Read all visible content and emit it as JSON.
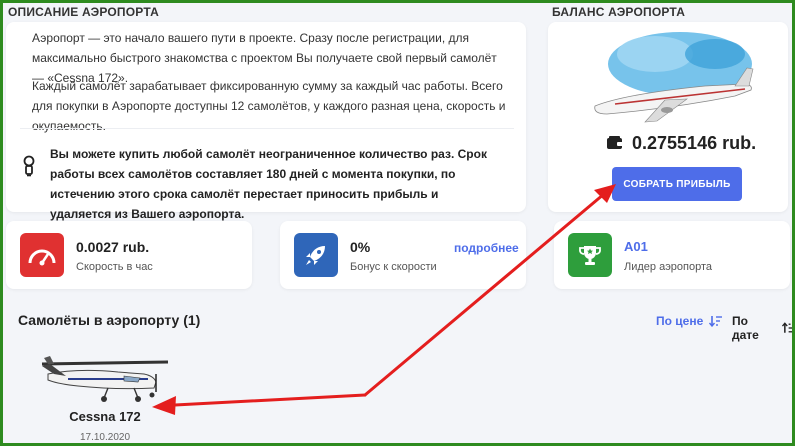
{
  "description": {
    "title": "ОПИСАНИЕ АЭРОПОРТА",
    "paragraph1": "Аэропорт — это начало вашего пути в проекте. Сразу после регистрации, для максимально быстрого знакомства с проектом Вы получаете свой первый самолёт — «Cessna 172».",
    "paragraph2": "Каждый самолёт зарабатывает фиксированную сумму за каждый час работы. Всего для покупки в Аэропорте доступны 12 самолётов, у каждого разная цена, скорость и окупаемость.",
    "notice": "Вы можете купить любой самолёт неограниченное количество раз. Срок работы всех самолётов составляет 180 дней с момента покупки, по истечению этого срока самолёт перестает приносить прибыль и удаляется из Вашего аэропорта."
  },
  "balance": {
    "title": "БАЛАНС АЭРОПОРТА",
    "amount": "0.2755146 rub.",
    "collect_label": "СОБРАТЬ ПРИБЫЛЬ"
  },
  "stats": [
    {
      "value": "0.0027 rub.",
      "label": "Скорость в час",
      "icon": "speedometer-icon",
      "color": "#e03131"
    },
    {
      "value": "0%",
      "label": "Бонус к скорости",
      "icon": "rocket-icon",
      "color": "#2f66b9",
      "link": "подробнее"
    },
    {
      "value": "A01",
      "label": "Лидер аэропорта",
      "icon": "trophy-icon",
      "color": "#2e9e3c"
    }
  ],
  "planes_section": {
    "title": "Самолёты в аэропорту (1)",
    "sort_price": "По цене",
    "sort_date": "По дате"
  },
  "planes": [
    {
      "name": "Cessna 172",
      "date": "17.10.2020"
    }
  ],
  "colors": {
    "accent": "#4e6de9",
    "annotation_arrow": "#e41e1e",
    "frame": "#2e8b1f"
  }
}
